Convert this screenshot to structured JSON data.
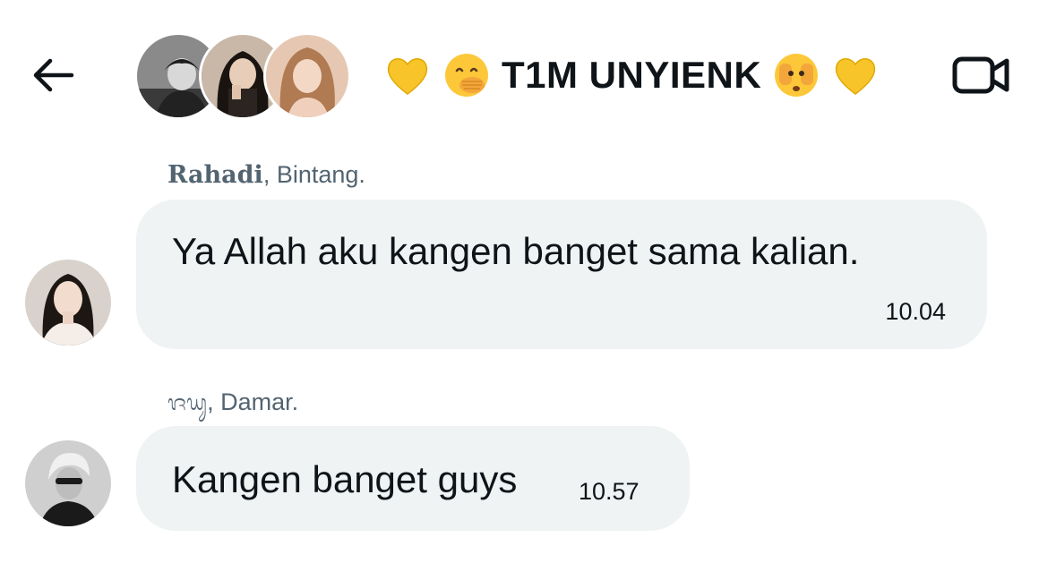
{
  "header": {
    "back_icon": "arrow-left-icon",
    "title": "T1M UNYIENK",
    "title_emojis_left": [
      "yellow-heart-emoji",
      "face-with-hand-over-mouth-emoji"
    ],
    "title_emojis_right": [
      "face-with-peeking-eye-emoji",
      "yellow-heart-emoji"
    ],
    "video_icon": "video-camera-icon",
    "group_avatars": [
      "avatar-1",
      "avatar-2",
      "avatar-3"
    ]
  },
  "messages": [
    {
      "sender_bold": "Rahadi",
      "sender_rest": ", Bintang.",
      "text": "Ya Allah aku kangen banget sama kalian.",
      "time": "10.04"
    },
    {
      "sender_bold": "ᬚᬬᬸ",
      "sender_rest": ", Damar.",
      "text": "Kangen banget guys",
      "time": "10.57"
    }
  ],
  "colors": {
    "bubble_bg": "#eff3f4",
    "text": "#0f1419",
    "secondary_text": "#536471",
    "background": "#ffffff"
  }
}
